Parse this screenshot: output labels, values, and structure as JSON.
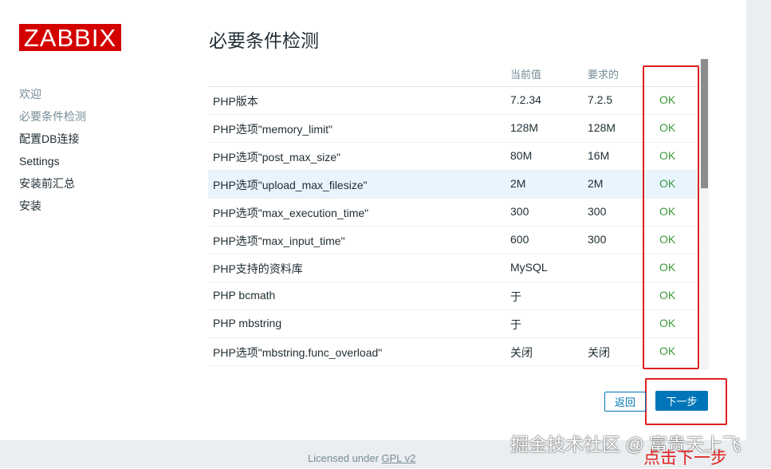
{
  "brand": {
    "logo_text": "ZABBIX"
  },
  "sidebar": {
    "items": [
      {
        "label": "欢迎",
        "state": "done"
      },
      {
        "label": "必要条件检测",
        "state": "done"
      },
      {
        "label": "配置DB连接",
        "state": "pending"
      },
      {
        "label": "Settings",
        "state": "pending"
      },
      {
        "label": "安装前汇总",
        "state": "pending"
      },
      {
        "label": "安装",
        "state": "pending"
      }
    ]
  },
  "main": {
    "title": "必要条件检测",
    "table": {
      "headers": {
        "name": "",
        "current": "当前值",
        "required": "要求的",
        "result": ""
      },
      "rows": [
        {
          "name": "PHP版本",
          "current": "7.2.34",
          "required": "7.2.5",
          "result": "OK"
        },
        {
          "name": "PHP选项\"memory_limit\"",
          "current": "128M",
          "required": "128M",
          "result": "OK"
        },
        {
          "name": "PHP选项\"post_max_size\"",
          "current": "80M",
          "required": "16M",
          "result": "OK"
        },
        {
          "name": "PHP选项\"upload_max_filesize\"",
          "current": "2M",
          "required": "2M",
          "result": "OK"
        },
        {
          "name": "PHP选项\"max_execution_time\"",
          "current": "300",
          "required": "300",
          "result": "OK"
        },
        {
          "name": "PHP选项\"max_input_time\"",
          "current": "600",
          "required": "300",
          "result": "OK"
        },
        {
          "name": "PHP支持的资料库",
          "current": "MySQL",
          "required": "",
          "result": "OK"
        },
        {
          "name": "PHP bcmath",
          "current": "于",
          "required": "",
          "result": "OK"
        },
        {
          "name": "PHP mbstring",
          "current": "于",
          "required": "",
          "result": "OK"
        },
        {
          "name": "PHP选项\"mbstring.func_overload\"",
          "current": "关闭",
          "required": "关闭",
          "result": "OK"
        }
      ]
    }
  },
  "buttons": {
    "back": "返回",
    "next": "下一步"
  },
  "footer": {
    "prefix": "Licensed under ",
    "link": "GPL v2"
  },
  "overlay": {
    "watermark": "掘金技术社区 @ 富贵天上飞",
    "annotation": "点击下一步"
  },
  "colors": {
    "brand": "#d40000",
    "ok": "#3c9a3c",
    "primary": "#0275b8",
    "annotation": "#e02020"
  }
}
